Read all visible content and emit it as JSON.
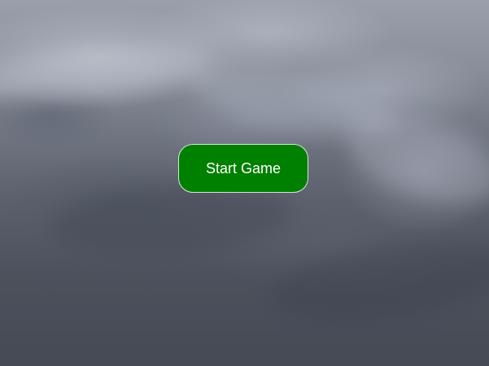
{
  "menu": {
    "start_label": "Start Game"
  },
  "colors": {
    "button_bg": "#008000",
    "button_text": "#ffffff",
    "sky_dark": "#454a55",
    "sky_light": "#9a9fab"
  }
}
